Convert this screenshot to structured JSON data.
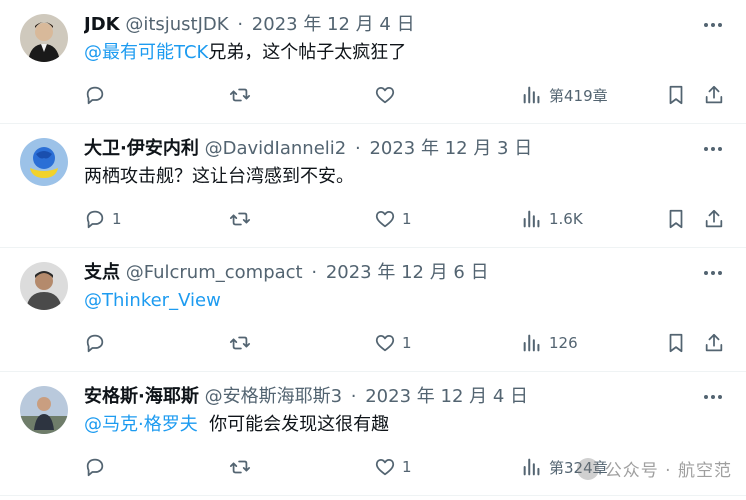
{
  "tweets": [
    {
      "name": "JDK",
      "handle": "@itsjustJDK",
      "separator": "·",
      "date": "2023 年 12 月 4 日",
      "mention": "@最有可能TCK",
      "text": "兄弟，这个帖子太疯狂了",
      "reply_count": "",
      "retweet_count": "",
      "like_count": "",
      "view_count": "第419章",
      "avatar_color": "#3a3a3a"
    },
    {
      "name": "大卫·伊安内利",
      "handle": "@DavidIanneli2",
      "separator": "·",
      "date": "2023 年 12 月 3 日",
      "mention": "",
      "text": "两栖攻击舰？这让台湾感到不安。",
      "reply_count": "1",
      "retweet_count": "",
      "like_count": "1",
      "view_count": "1.6K",
      "avatar_color": "#2b6fd6"
    },
    {
      "name": "支点",
      "handle": "@Fulcrum_compact",
      "separator": "·",
      "date": "2023 年 12 月 6 日",
      "mention": "@Thinker_View",
      "text": "",
      "reply_count": "",
      "retweet_count": "",
      "like_count": "1",
      "view_count": "126",
      "avatar_color": "#4a4a4a"
    },
    {
      "name": "安格斯·海耶斯",
      "handle": "@安格斯海耶斯3",
      "separator": "·",
      "date": "2023 年 12 月 4 日",
      "mention": "@马克·格罗夫",
      "text": "  你可能会发现这很有趣",
      "reply_count": "",
      "retweet_count": "",
      "like_count": "1",
      "view_count": "第324章",
      "avatar_color": "#8a9bb0"
    }
  ],
  "watermark": {
    "text": "公众号 · 航空范"
  },
  "colors": {
    "link": "#1d9bf0",
    "muted": "#536471",
    "text": "#0f1419"
  }
}
